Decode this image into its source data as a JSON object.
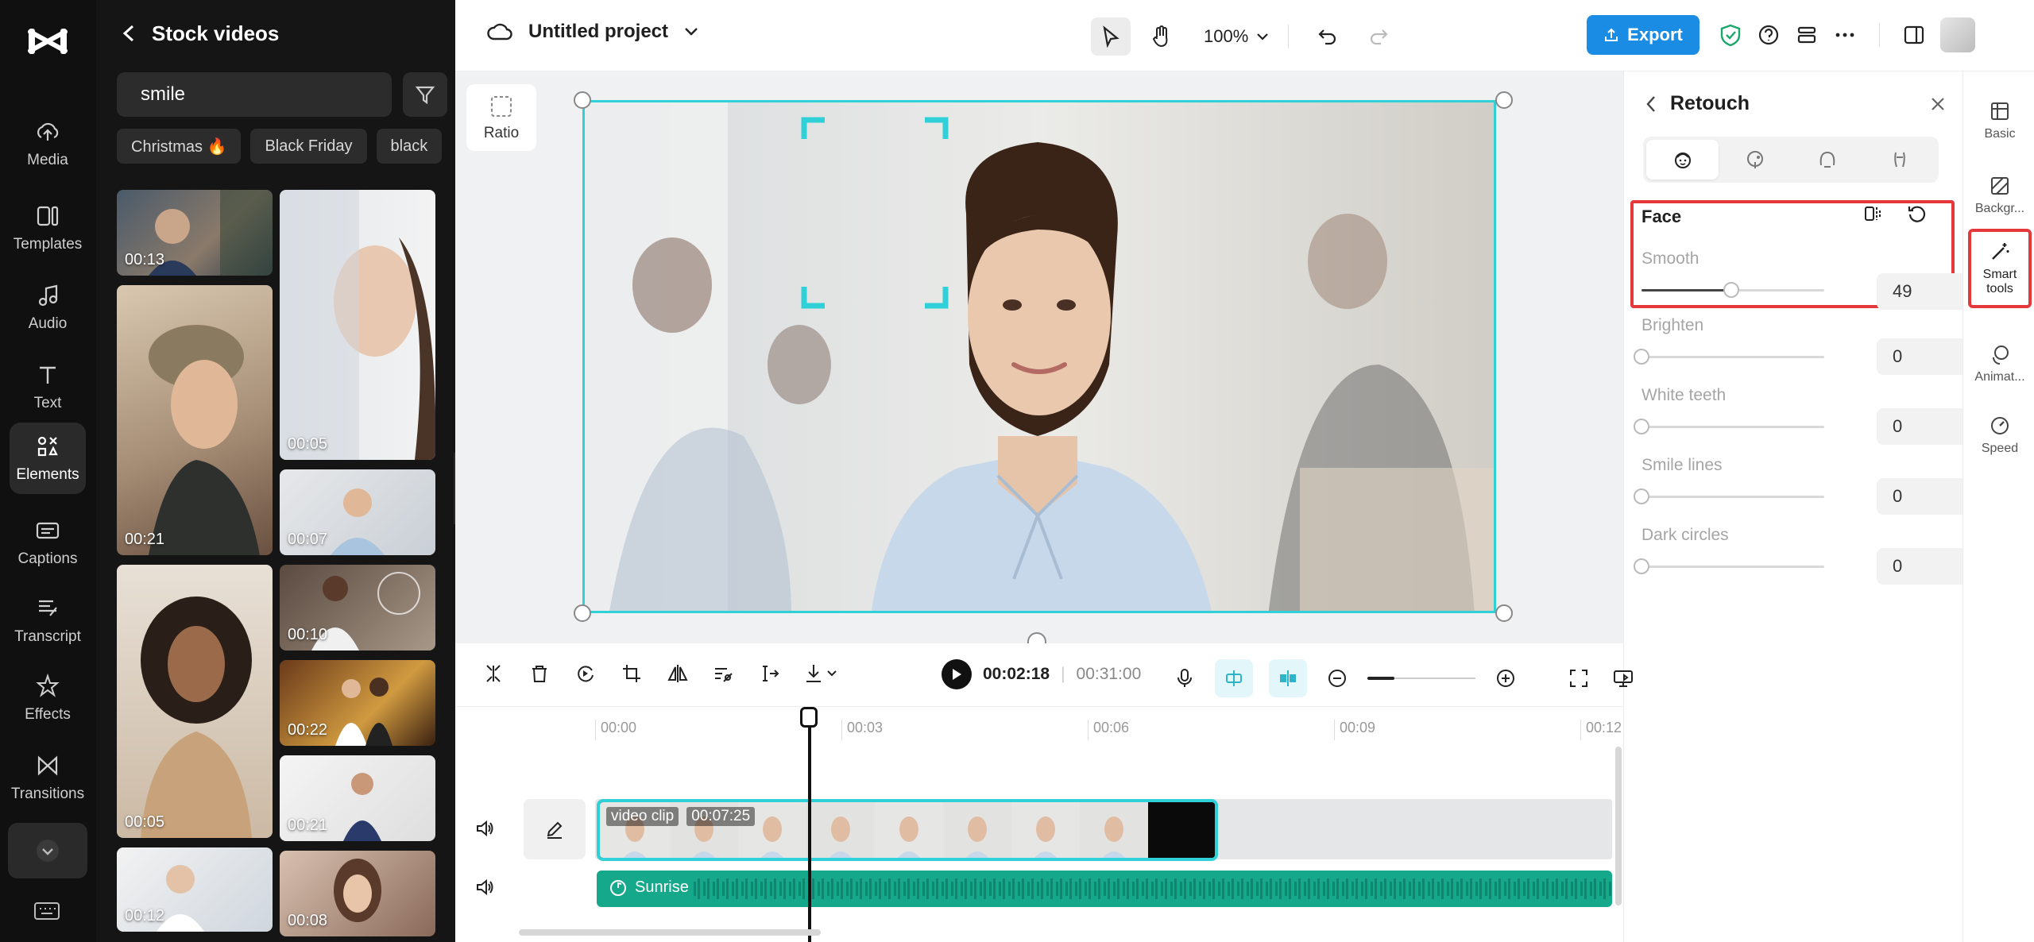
{
  "nav": {
    "items": [
      {
        "label": "Media",
        "icon": "cloud-upload-icon"
      },
      {
        "label": "Templates",
        "icon": "templates-icon"
      },
      {
        "label": "Audio",
        "icon": "music-note-icon"
      },
      {
        "label": "Text",
        "icon": "text-icon"
      },
      {
        "label": "Elements",
        "icon": "elements-icon"
      },
      {
        "label": "Captions",
        "icon": "captions-icon"
      },
      {
        "label": "Transcript",
        "icon": "transcript-icon"
      },
      {
        "label": "Effects",
        "icon": "effects-icon"
      },
      {
        "label": "Transitions",
        "icon": "transitions-icon"
      }
    ],
    "active": "Elements"
  },
  "panel": {
    "title": "Stock videos",
    "search_value": "smile",
    "chips": [
      "Christmas 🔥",
      "Black Friday",
      "black"
    ],
    "thumbs": [
      "00:13",
      "00:05",
      "00:21",
      "00:07",
      "00:10",
      "00:05",
      "00:22",
      "00:21",
      "00:12",
      "00:08"
    ]
  },
  "topbar": {
    "project_name": "Untitled project",
    "zoom": "100%",
    "export_label": "Export"
  },
  "canvas": {
    "ratio_label": "Ratio"
  },
  "retouch": {
    "title": "Retouch",
    "section": "Face",
    "sliders": [
      {
        "label": "Smooth",
        "value": "49"
      },
      {
        "label": "Brighten",
        "value": "0"
      },
      {
        "label": "White teeth",
        "value": "0"
      },
      {
        "label": "Smile lines",
        "value": "0"
      },
      {
        "label": "Dark circles",
        "value": "0"
      }
    ]
  },
  "rrail": {
    "items": [
      "Basic",
      "Backgr...",
      "Smart tools",
      "Animat...",
      "Speed"
    ]
  },
  "playback": {
    "current": "00:02:18",
    "divider": "|",
    "total": "00:31:00"
  },
  "timeline": {
    "ticks": [
      "00:00",
      "00:03",
      "00:06",
      "00:09",
      "00:12"
    ],
    "clip_name": "video clip",
    "clip_duration": "00:07:25",
    "audio_name": "Sunrise"
  },
  "colors": {
    "accent": "#2fd0d8",
    "export_blue": "#1b8ce3",
    "highlight_red": "#e5383b",
    "audio_green": "#16a88a"
  }
}
